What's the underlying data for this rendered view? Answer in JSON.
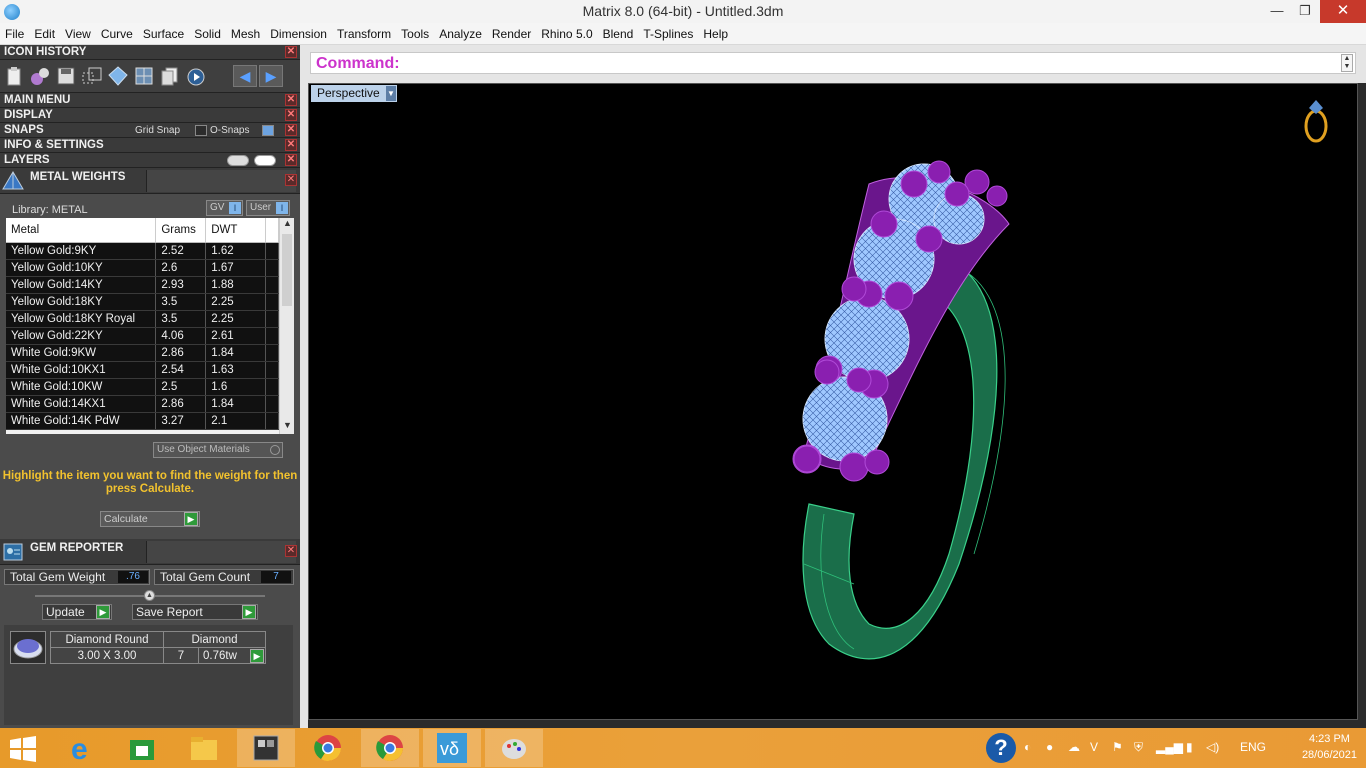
{
  "window": {
    "title": "Matrix 8.0 (64-bit) - Untitled.3dm",
    "minimize_glyph": "—",
    "restore_glyph": "❐",
    "close_glyph": "✕"
  },
  "menu": [
    "File",
    "Edit",
    "View",
    "Curve",
    "Surface",
    "Solid",
    "Mesh",
    "Dimension",
    "Transform",
    "Tools",
    "Analyze",
    "Render",
    "Rhino 5.0",
    "Blend",
    "T-Splines",
    "Help"
  ],
  "panels": {
    "icon_history": "ICON HISTORY",
    "main_menu": "MAIN MENU",
    "display": "DISPLAY",
    "snaps": "SNAPS",
    "grid_snap": "Grid Snap",
    "o_snaps": "O-Snaps",
    "info_settings": "INFO & SETTINGS",
    "layers": "LAYERS"
  },
  "metal_weights": {
    "title": "METAL WEIGHTS",
    "library_label": "Library: METAL",
    "gv_label": "GV",
    "user_label": "User",
    "columns": [
      "Metal",
      "Grams",
      "DWT"
    ],
    "rows": [
      [
        "Yellow Gold:9KY",
        "2.52",
        "1.62"
      ],
      [
        "Yellow Gold:10KY",
        "2.6",
        "1.67"
      ],
      [
        "Yellow Gold:14KY",
        "2.93",
        "1.88"
      ],
      [
        "Yellow Gold:18KY",
        "3.5",
        "2.25"
      ],
      [
        "Yellow Gold:18KY Royal",
        "3.5",
        "2.25"
      ],
      [
        "Yellow Gold:22KY",
        "4.06",
        "2.61"
      ],
      [
        "White Gold:9KW",
        "2.86",
        "1.84"
      ],
      [
        "White Gold:10KX1",
        "2.54",
        "1.63"
      ],
      [
        "White Gold:10KW",
        "2.5",
        "1.6"
      ],
      [
        "White Gold:14KX1",
        "2.86",
        "1.84"
      ],
      [
        "White Gold:14K PdW",
        "3.27",
        "2.1"
      ]
    ],
    "use_object_materials": "Use Object Materials",
    "hint": "Highlight the item you want to find the weight for then press Calculate.",
    "calculate": "Calculate"
  },
  "gem_reporter": {
    "title": "GEM REPORTER",
    "total_weight_label": "Total Gem Weight",
    "total_weight_value": ".76",
    "total_count_label": "Total Gem Count",
    "total_count_value": "7",
    "update": "Update",
    "save_report": "Save Report",
    "gem_name": "Diamond Round",
    "gem_type": "Diamond",
    "gem_size": "3.00 X 3.00",
    "gem_count": "7",
    "gem_weight": "0.76tw"
  },
  "command": {
    "label": "Command:"
  },
  "viewport": {
    "name": "Perspective"
  },
  "colors": {
    "shank": "#1f7a55",
    "gem": "#9fc8ff",
    "prong": "#8a1fb0",
    "command_label": "#cc33cc",
    "hint": "#f2c22e"
  },
  "taskbar": {
    "apps": [
      "windows-start",
      "internet-explorer",
      "store",
      "file-explorer",
      "matrix",
      "chrome",
      "chrome",
      "vs-app",
      "paint"
    ],
    "lang": "ENG",
    "time": "4:23 PM",
    "date": "28/06/2021"
  }
}
